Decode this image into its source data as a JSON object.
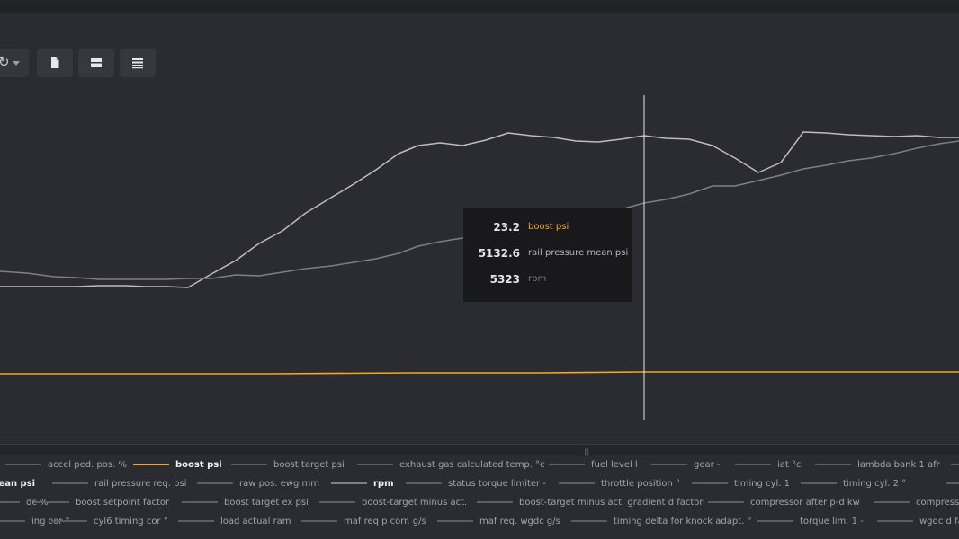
{
  "toolbar": {
    "refresh_icon": "refresh-icon",
    "buttons": [
      {
        "icon": "file-icon"
      },
      {
        "icon": "split-view-icon"
      },
      {
        "icon": "list-view-icon"
      }
    ]
  },
  "colors": {
    "boost": "#f5a623",
    "rail_pressure": "#c4b8c4",
    "rpm": "#7e7e84",
    "crosshair": "#e6e6e6"
  },
  "chart_data": {
    "type": "line",
    "series": [
      {
        "name": "rail pressure mean psi",
        "color": "#c4b8c4",
        "values": [
          [
            0,
            319
          ],
          [
            30,
            319
          ],
          [
            60,
            319
          ],
          [
            85,
            319
          ],
          [
            110,
            318
          ],
          [
            140,
            318
          ],
          [
            160,
            319
          ],
          [
            185,
            319
          ],
          [
            209,
            320
          ],
          [
            235,
            305
          ],
          [
            262,
            290
          ],
          [
            288,
            271
          ],
          [
            314,
            257
          ],
          [
            340,
            237
          ],
          [
            368,
            220
          ],
          [
            393,
            205
          ],
          [
            418,
            189
          ],
          [
            443,
            171
          ],
          [
            465,
            162
          ],
          [
            489,
            159
          ],
          [
            514,
            162
          ],
          [
            540,
            156
          ],
          [
            565,
            148
          ],
          [
            590,
            151
          ],
          [
            616,
            153
          ],
          [
            640,
            157
          ],
          [
            665,
            158
          ],
          [
            690,
            155
          ],
          [
            716,
            151
          ],
          [
            740,
            154
          ],
          [
            766,
            155
          ],
          [
            792,
            162
          ],
          [
            817,
            176
          ],
          [
            843,
            192
          ],
          [
            868,
            181
          ],
          [
            893,
            147
          ],
          [
            918,
            148
          ],
          [
            943,
            150
          ],
          [
            968,
            151
          ],
          [
            994,
            152
          ],
          [
            1019,
            151
          ],
          [
            1044,
            153
          ],
          [
            1066,
            153
          ]
        ]
      },
      {
        "name": "rpm",
        "color": "#7e7e84",
        "values": [
          [
            0,
            302
          ],
          [
            30,
            304
          ],
          [
            60,
            308
          ],
          [
            85,
            309
          ],
          [
            110,
            311
          ],
          [
            140,
            311
          ],
          [
            160,
            311
          ],
          [
            185,
            311
          ],
          [
            209,
            310
          ],
          [
            235,
            310
          ],
          [
            262,
            306
          ],
          [
            288,
            307
          ],
          [
            314,
            303
          ],
          [
            340,
            299
          ],
          [
            368,
            296
          ],
          [
            393,
            292
          ],
          [
            418,
            288
          ],
          [
            443,
            282
          ],
          [
            465,
            274
          ],
          [
            489,
            269
          ],
          [
            514,
            265
          ],
          [
            540,
            261
          ],
          [
            565,
            255
          ],
          [
            590,
            250
          ],
          [
            616,
            246
          ],
          [
            640,
            241
          ],
          [
            665,
            237
          ],
          [
            690,
            233
          ],
          [
            716,
            226
          ],
          [
            740,
            222
          ],
          [
            766,
            216
          ],
          [
            792,
            207
          ],
          [
            817,
            207
          ],
          [
            843,
            201
          ],
          [
            868,
            195
          ],
          [
            893,
            188
          ],
          [
            918,
            184
          ],
          [
            943,
            179
          ],
          [
            968,
            176
          ],
          [
            994,
            171
          ],
          [
            1019,
            165
          ],
          [
            1044,
            160
          ],
          [
            1066,
            157
          ]
        ]
      },
      {
        "name": "boost psi",
        "color": "#f5a623",
        "values": [
          [
            0,
            416
          ],
          [
            150,
            416
          ],
          [
            300,
            416
          ],
          [
            460,
            415
          ],
          [
            600,
            415
          ],
          [
            716,
            414
          ],
          [
            800,
            414
          ],
          [
            950,
            414
          ],
          [
            1066,
            414
          ]
        ]
      }
    ],
    "crosshair_x": 716
  },
  "tooltip": {
    "rows": [
      {
        "value": "23.2",
        "name": "boost psi",
        "color": "#f5a623"
      },
      {
        "value": "5132.6",
        "name": "rail pressure mean psi",
        "color": "#b4b4ba"
      },
      {
        "value": "5323",
        "name": "rpm",
        "color": "#7a7a80"
      }
    ]
  },
  "legend": {
    "rows": [
      [
        {
          "label": "accel ped. pos. %",
          "on": false,
          "color": "#5d5e63"
        },
        {
          "label": "boost psi",
          "on": true,
          "color": "#f5a623"
        },
        {
          "label": "boost target psi",
          "on": false,
          "color": "#5d5e63"
        },
        {
          "label": "exhaust gas calculated temp. °c",
          "on": false,
          "color": "#5d5e63"
        },
        {
          "label": "fuel level l",
          "on": false,
          "color": "#5d5e63"
        },
        {
          "label": "gear -",
          "on": false,
          "color": "#5d5e63"
        },
        {
          "label": "iat °c",
          "on": false,
          "color": "#5d5e63"
        },
        {
          "label": "lambda bank 1 afr",
          "on": false,
          "color": "#5d5e63"
        },
        {
          "label": "",
          "on": false,
          "color": "#5d5e63"
        }
      ],
      [
        {
          "label": "mean psi",
          "on": true,
          "color": "#c4b8c4"
        },
        {
          "label": "rail pressure req. psi",
          "on": false,
          "color": "#5d5e63"
        },
        {
          "label": "raw pos. ewg mm",
          "on": false,
          "color": "#5d5e63"
        },
        {
          "label": "rpm",
          "on": true,
          "color": "#7e7e84"
        },
        {
          "label": "status torque limiter -",
          "on": false,
          "color": "#5d5e63"
        },
        {
          "label": "throttle position °",
          "on": false,
          "color": "#5d5e63"
        },
        {
          "label": "timing cyl. 1",
          "on": false,
          "color": "#5d5e63"
        },
        {
          "label": "timing cyl. 2 °",
          "on": false,
          "color": "#5d5e63"
        },
        {
          "label": "",
          "on": false,
          "color": "#5d5e63"
        }
      ],
      [
        {
          "label": "dc %",
          "on": false,
          "color": "#5d5e63"
        },
        {
          "label": "boost setpoint factor",
          "on": false,
          "color": "#5d5e63"
        },
        {
          "label": "boost target ex psi",
          "on": false,
          "color": "#5d5e63"
        },
        {
          "label": "boost-target minus act.",
          "on": false,
          "color": "#5d5e63"
        },
        {
          "label": "boost-target minus act. gradient d factor",
          "on": false,
          "color": "#5d5e63"
        },
        {
          "label": "compressor after p-d kw",
          "on": false,
          "color": "#5d5e63"
        },
        {
          "label": "compresso",
          "on": false,
          "color": "#5d5e63"
        }
      ],
      [
        {
          "label": "ing cor °",
          "on": false,
          "color": "#5d5e63"
        },
        {
          "label": "cyl6 timing cor °",
          "on": false,
          "color": "#5d5e63"
        },
        {
          "label": "load actual ram",
          "on": false,
          "color": "#5d5e63"
        },
        {
          "label": "maf req p corr. g/s",
          "on": false,
          "color": "#5d5e63"
        },
        {
          "label": "maf req. wgdc g/s",
          "on": false,
          "color": "#5d5e63"
        },
        {
          "label": "timing delta for knock adapt. °",
          "on": false,
          "color": "#5d5e63"
        },
        {
          "label": "torque lim. 1 -",
          "on": false,
          "color": "#5d5e63"
        },
        {
          "label": "wgdc d fa",
          "on": false,
          "color": "#5d5e63"
        }
      ]
    ]
  }
}
